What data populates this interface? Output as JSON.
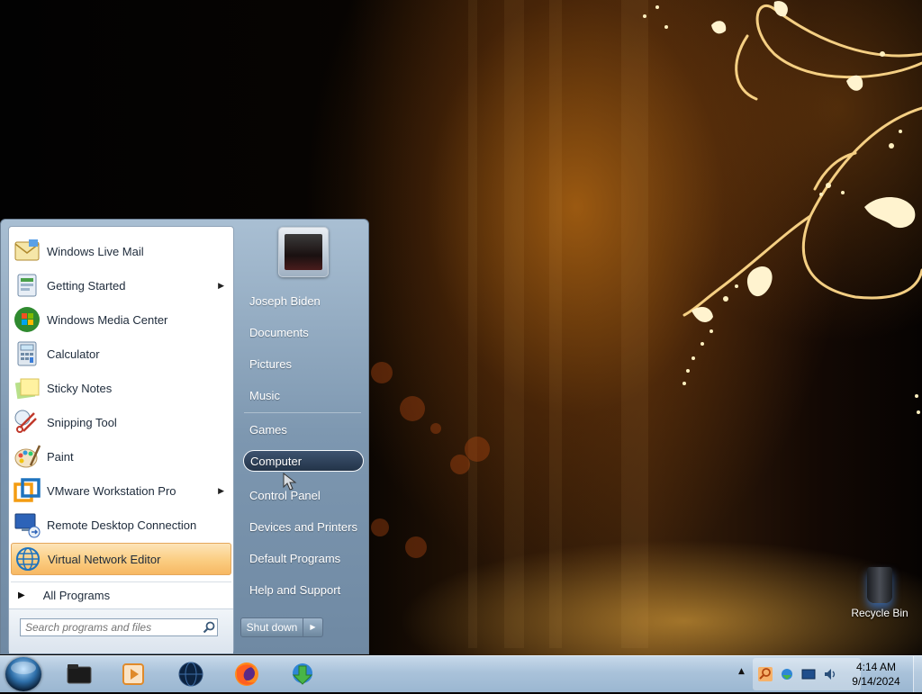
{
  "desktop": {
    "recycle_bin_label": "Recycle Bin"
  },
  "start_menu": {
    "programs": [
      {
        "label": "Windows Live Mail",
        "icon": "windows-live-mail-icon",
        "submenu": false
      },
      {
        "label": "Getting Started",
        "icon": "getting-started-icon",
        "submenu": true
      },
      {
        "label": "Windows Media Center",
        "icon": "windows-media-center-icon",
        "submenu": false
      },
      {
        "label": "Calculator",
        "icon": "calculator-icon",
        "submenu": false
      },
      {
        "label": "Sticky Notes",
        "icon": "sticky-notes-icon",
        "submenu": false
      },
      {
        "label": "Snipping Tool",
        "icon": "snipping-tool-icon",
        "submenu": false
      },
      {
        "label": "Paint",
        "icon": "paint-icon",
        "submenu": false
      },
      {
        "label": "VMware Workstation Pro",
        "icon": "vmware-icon",
        "submenu": true
      },
      {
        "label": "Remote Desktop Connection",
        "icon": "remote-desktop-icon",
        "submenu": false
      },
      {
        "label": "Virtual Network Editor",
        "icon": "virtual-network-editor-icon",
        "submenu": false,
        "highlighted": true
      }
    ],
    "all_programs_label": "All Programs",
    "search_placeholder": "Search programs and files",
    "places": [
      {
        "label": "Joseph Biden"
      },
      {
        "label": "Documents"
      },
      {
        "label": "Pictures"
      },
      {
        "label": "Music"
      },
      {
        "label": "Games"
      },
      {
        "label": "Computer",
        "selected": true
      },
      {
        "label": "Control Panel"
      },
      {
        "label": "Devices and Printers"
      },
      {
        "label": "Default Programs"
      },
      {
        "label": "Help and Support"
      }
    ],
    "shutdown_label": "Shut down"
  },
  "taskbar": {
    "pinned": [
      {
        "icon": "dark-folder-icon"
      },
      {
        "icon": "media-player-icon"
      },
      {
        "icon": "globe-icon"
      },
      {
        "icon": "firefox-icon"
      },
      {
        "icon": "download-manager-icon"
      }
    ],
    "tray_icons": [
      "search-tray-icon",
      "network-tray-icon",
      "monitor-tray-icon",
      "volume-tray-icon"
    ],
    "clock_time": "4:14 AM",
    "clock_date": "9/14/2024"
  },
  "colors": {
    "highlight": "#fbcf85",
    "start_menu_right": "#7d97b0",
    "taskbar": "#a9c2da",
    "program_text": "#1d2a3a"
  }
}
